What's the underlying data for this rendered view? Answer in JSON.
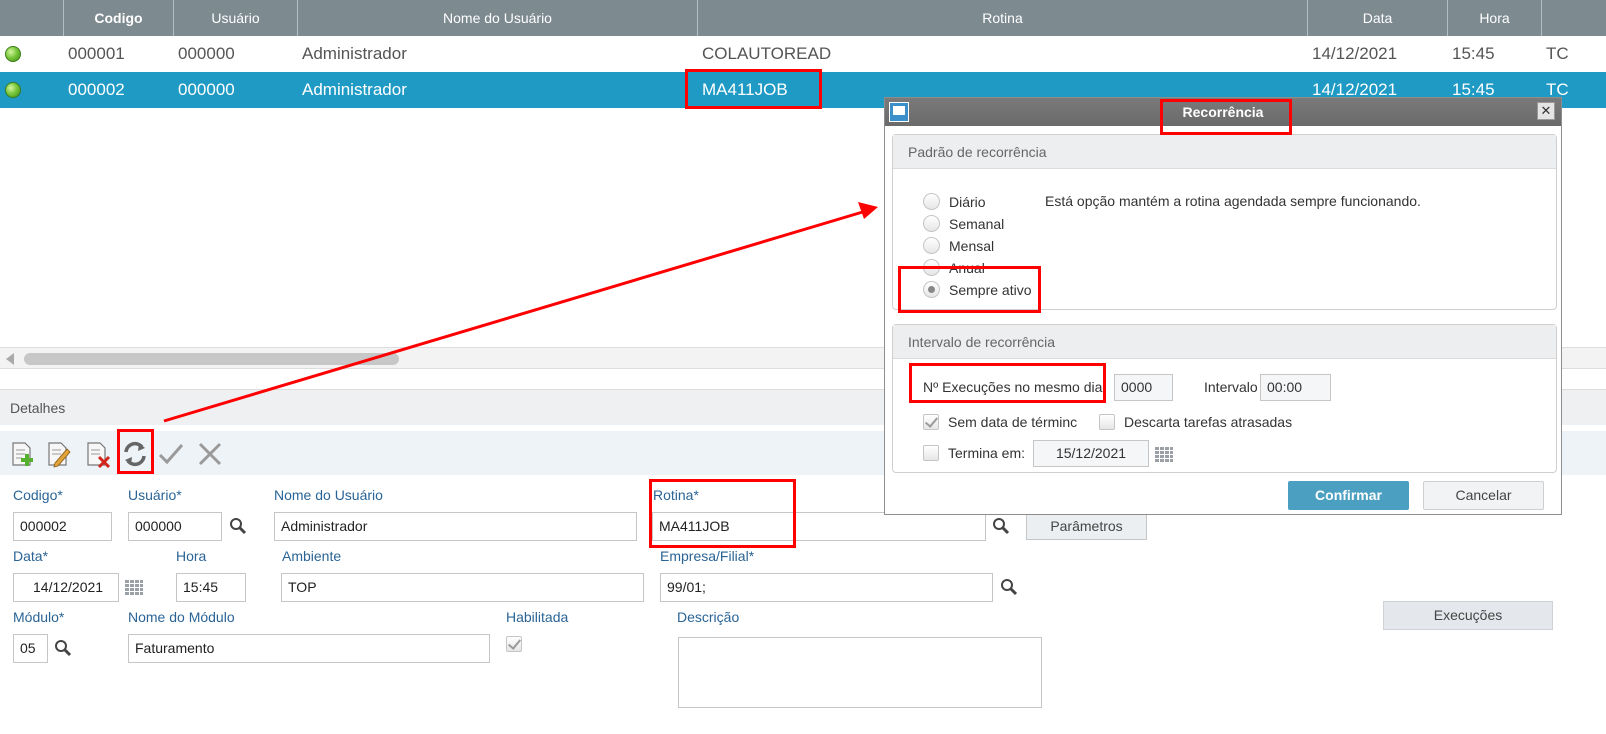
{
  "grid": {
    "columns": {
      "codigo": "Codigo",
      "usuario": "Usuário",
      "nome": "Nome do Usuário",
      "rotina": "Rotina",
      "data": "Data",
      "hora": "Hora"
    },
    "rows": [
      {
        "codigo": "000001",
        "usuario": "000000",
        "nome": "Administrador",
        "rotina": "COLAUTOREAD",
        "data": "14/12/2021",
        "hora": "15:45",
        "extra": "TC"
      },
      {
        "codigo": "000002",
        "usuario": "000000",
        "nome": "Administrador",
        "rotina": "MA411JOB",
        "data": "14/12/2021",
        "hora": "15:45",
        "extra": "TC"
      }
    ]
  },
  "details": {
    "title": "Detalhes",
    "fields": {
      "codigo_label": "Codigo*",
      "codigo_value": "000002",
      "usuario_label": "Usuário*",
      "usuario_value": "000000",
      "nome_usuario_label": "Nome do Usuário",
      "nome_usuario_value": "Administrador",
      "rotina_label": "Rotina*",
      "rotina_value": "MA411JOB",
      "parametros_button": "Parâmetros",
      "data_label": "Data*",
      "data_value": "14/12/2021",
      "hora_label": "Hora",
      "hora_value": "15:45",
      "ambiente_label": "Ambiente",
      "ambiente_value": "TOP",
      "empresa_label": "Empresa/Filial*",
      "empresa_value": "99/01;",
      "modulo_label": "Módulo*",
      "modulo_value": "05",
      "nome_modulo_label": "Nome do Módulo",
      "nome_modulo_value": "Faturamento",
      "habilitada_label": "Habilitada",
      "descricao_label": "Descrição",
      "descricao_value": ""
    }
  },
  "dialog": {
    "title": "Recorrência",
    "padrao_header": "Padrão de recorrência",
    "options": [
      {
        "label": "Diário",
        "selected": false
      },
      {
        "label": "Semanal",
        "selected": false
      },
      {
        "label": "Mensal",
        "selected": false
      },
      {
        "label": "Anual",
        "selected": false
      },
      {
        "label": "Sempre ativo",
        "selected": true
      }
    ],
    "description": "Está opção mantém a rotina agendada sempre funcionando.",
    "intervalo_header": "Intervalo de recorrência",
    "execucoes_label": "Nº Execuções no mesmo dia",
    "execucoes_value": "0000",
    "intervalo_label": "Intervalo",
    "intervalo_value": "00:00",
    "execucoes_button": "Execuções",
    "sem_data_label": "Sem data de términc",
    "descarta_label": "Descarta tarefas atrasadas",
    "termina_label": "Termina em:",
    "termina_value": "15/12/2021",
    "confirm_button": "Confirmar",
    "cancel_button": "Cancelar"
  },
  "colors": {
    "grid_header": "#7d8a90",
    "selected_row": "#1f9ac4",
    "confirm_button": "#4b9fc0",
    "annotation": "#ff0000"
  }
}
